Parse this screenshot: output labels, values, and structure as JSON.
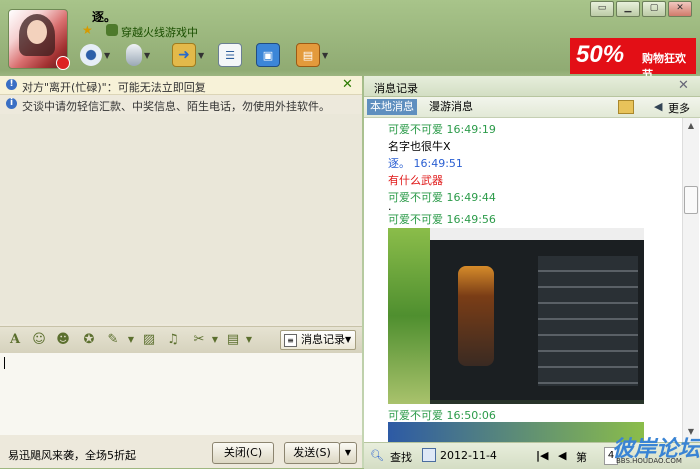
{
  "contact": {
    "name": "逐。",
    "status_text": "穿越火线游戏中"
  },
  "toolbar": {
    "icons": [
      "webcam-icon",
      "microphone-icon",
      "file-transfer-icon",
      "app-list-icon",
      "remote-assist-icon",
      "more-apps-icon"
    ]
  },
  "window_buttons": [
    "▭",
    "▁",
    "▢",
    "✕"
  ],
  "ad": {
    "big": "50%",
    "small": "购物狂欢节"
  },
  "left": {
    "notice_busy": "对方\"离开(忙碌)\"：可能无法立即回复",
    "notice_safety": "交谈中请勿轻信汇款、中奖信息、陌生电话，勿使用外挂软件。",
    "history_button": "消息记录",
    "promo": "易迅飓风来袭，全场5折起",
    "close_button": "关闭(C)",
    "send_button": "发送(S)"
  },
  "right": {
    "title": "消息记录",
    "tab_local": "本地消息",
    "tab_roaming": "漫游消息",
    "more": "更多",
    "messages": [
      {
        "text": "可爱不可爱 16:49:19",
        "color": "green"
      },
      {
        "text": "名字也很牛X",
        "color": "black"
      },
      {
        "text": "逐。   16:49:51",
        "color": "blue"
      },
      {
        "text": "有什么武器",
        "color": "red"
      },
      {
        "text": "可爱不可爱 16:49:44",
        "color": "green"
      },
      {
        "text": ".",
        "color": "black"
      },
      {
        "text": "可爱不可爱 16:49:56",
        "color": "green"
      },
      {
        "text": "可爱不可爱 16:50:06",
        "color": "green"
      }
    ],
    "footer": {
      "search": "查找",
      "date": "2012-11-4",
      "page_label": "第",
      "page_value": "4"
    },
    "watermark": "彼岸论坛",
    "watermark_url": "BBS.HOUDAO.COM"
  }
}
